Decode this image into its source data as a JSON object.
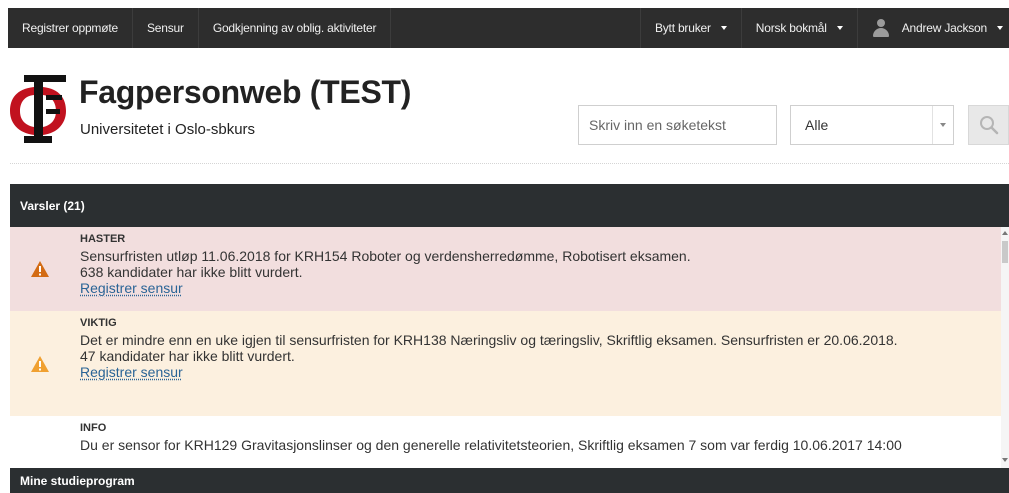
{
  "topnav": {
    "left_items": [
      "Registrer oppmøte",
      "Sensur",
      "Godkjenning av oblig. aktiviteter"
    ],
    "switch_user": "Bytt bruker",
    "language": "Norsk bokmål",
    "user_name": "Andrew Jackson"
  },
  "brand": {
    "title": "Fagpersonweb (TEST)",
    "subtitle": "Universitetet i Oslo-sbkurs"
  },
  "search": {
    "placeholder": "Skriv inn en søketekst",
    "scope": "Alle"
  },
  "alerts_panel": {
    "title": "Varsler (21)",
    "items": [
      {
        "label": "HASTER",
        "lines": [
          "Sensurfristen utløp 11.06.2018 for KRH154 Roboter og verdensherredømme, Robotisert eksamen.",
          "638 kandidater har ikke blitt vurdert."
        ],
        "link": "Registrer sensur",
        "icon": "warning-icon",
        "icon_color": "#d36b14",
        "background": "#f2dede"
      },
      {
        "label": "VIKTIG",
        "lines": [
          "Det er mindre enn en uke igjen til sensurfristen for KRH138 Næringsliv og tæringsliv, Skriftlig eksamen. Sensurfristen er 20.06.2018.",
          "47 kandidater har ikke blitt vurdert."
        ],
        "link": "Registrer sensur",
        "icon": "warning-icon",
        "icon_color": "#f0a030",
        "background": "#fcf0df"
      },
      {
        "label": "INFO",
        "lines": [
          "Du er sensor for KRH129 Gravitasjonslinser og den generelle relativitetsteorien, Skriftlig eksamen 7 som var ferdig 10.06.2017 14:00"
        ],
        "icon": "info-icon",
        "icon_color": "#3a87c8",
        "background": "#ffffff"
      }
    ]
  },
  "study_panel": {
    "title": "Mine studieprogram"
  },
  "colors": {
    "topbar": "#2d2d2d",
    "panel_header": "#2b2f31",
    "link": "#2a6496"
  }
}
